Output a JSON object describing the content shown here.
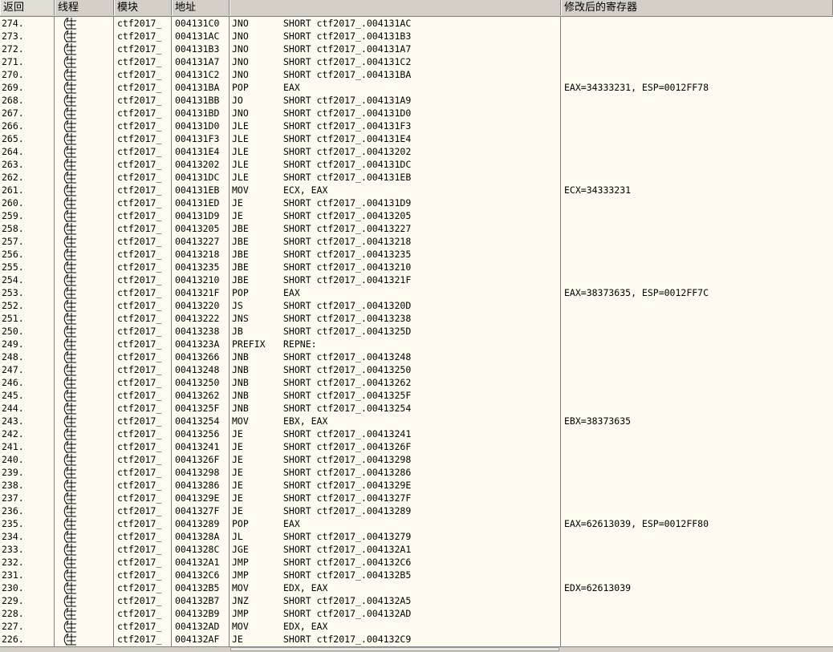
{
  "header": {
    "col_return": "返回",
    "col_thread": "线程",
    "col_module": "模块",
    "col_address": "地址",
    "col_command": "",
    "col_modified_regs": "修改后的寄存器"
  },
  "thread_icon": "main-thread-icon",
  "rows": [
    {
      "ret": "274.",
      "mod": "ctf2017_",
      "addr": "004131C0",
      "mn": "JNO",
      "op": "SHORT ctf2017_.004131AC",
      "reg": ""
    },
    {
      "ret": "273.",
      "mod": "ctf2017_",
      "addr": "004131AC",
      "mn": "JNO",
      "op": "SHORT ctf2017_.004131B3",
      "reg": ""
    },
    {
      "ret": "272.",
      "mod": "ctf2017_",
      "addr": "004131B3",
      "mn": "JNO",
      "op": "SHORT ctf2017_.004131A7",
      "reg": ""
    },
    {
      "ret": "271.",
      "mod": "ctf2017_",
      "addr": "004131A7",
      "mn": "JNO",
      "op": "SHORT ctf2017_.004131C2",
      "reg": ""
    },
    {
      "ret": "270.",
      "mod": "ctf2017_",
      "addr": "004131C2",
      "mn": "JNO",
      "op": "SHORT ctf2017_.004131BA",
      "reg": ""
    },
    {
      "ret": "269.",
      "mod": "ctf2017_",
      "addr": "004131BA",
      "mn": "POP",
      "op": "EAX",
      "reg": "EAX=34333231, ESP=0012FF78"
    },
    {
      "ret": "268.",
      "mod": "ctf2017_",
      "addr": "004131BB",
      "mn": "JO",
      "op": "SHORT ctf2017_.004131A9",
      "reg": ""
    },
    {
      "ret": "267.",
      "mod": "ctf2017_",
      "addr": "004131BD",
      "mn": "JNO",
      "op": "SHORT ctf2017_.004131D0",
      "reg": ""
    },
    {
      "ret": "266.",
      "mod": "ctf2017_",
      "addr": "004131D0",
      "mn": "JLE",
      "op": "SHORT ctf2017_.004131F3",
      "reg": ""
    },
    {
      "ret": "265.",
      "mod": "ctf2017_",
      "addr": "004131F3",
      "mn": "JLE",
      "op": "SHORT ctf2017_.004131E4",
      "reg": ""
    },
    {
      "ret": "264.",
      "mod": "ctf2017_",
      "addr": "004131E4",
      "mn": "JLE",
      "op": "SHORT ctf2017_.00413202",
      "reg": ""
    },
    {
      "ret": "263.",
      "mod": "ctf2017_",
      "addr": "00413202",
      "mn": "JLE",
      "op": "SHORT ctf2017_.004131DC",
      "reg": ""
    },
    {
      "ret": "262.",
      "mod": "ctf2017_",
      "addr": "004131DC",
      "mn": "JLE",
      "op": "SHORT ctf2017_.004131EB",
      "reg": ""
    },
    {
      "ret": "261.",
      "mod": "ctf2017_",
      "addr": "004131EB",
      "mn": "MOV",
      "op": "ECX, EAX",
      "reg": "ECX=34333231"
    },
    {
      "ret": "260.",
      "mod": "ctf2017_",
      "addr": "004131ED",
      "mn": "JE",
      "op": "SHORT ctf2017_.004131D9",
      "reg": ""
    },
    {
      "ret": "259.",
      "mod": "ctf2017_",
      "addr": "004131D9",
      "mn": "JE",
      "op": "SHORT ctf2017_.00413205",
      "reg": ""
    },
    {
      "ret": "258.",
      "mod": "ctf2017_",
      "addr": "00413205",
      "mn": "JBE",
      "op": "SHORT ctf2017_.00413227",
      "reg": ""
    },
    {
      "ret": "257.",
      "mod": "ctf2017_",
      "addr": "00413227",
      "mn": "JBE",
      "op": "SHORT ctf2017_.00413218",
      "reg": ""
    },
    {
      "ret": "256.",
      "mod": "ctf2017_",
      "addr": "00413218",
      "mn": "JBE",
      "op": "SHORT ctf2017_.00413235",
      "reg": ""
    },
    {
      "ret": "255.",
      "mod": "ctf2017_",
      "addr": "00413235",
      "mn": "JBE",
      "op": "SHORT ctf2017_.00413210",
      "reg": ""
    },
    {
      "ret": "254.",
      "mod": "ctf2017_",
      "addr": "00413210",
      "mn": "JBE",
      "op": "SHORT ctf2017_.0041321F",
      "reg": ""
    },
    {
      "ret": "253.",
      "mod": "ctf2017_",
      "addr": "0041321F",
      "mn": "POP",
      "op": "EAX",
      "reg": "EAX=38373635, ESP=0012FF7C"
    },
    {
      "ret": "252.",
      "mod": "ctf2017_",
      "addr": "00413220",
      "mn": "JS",
      "op": "SHORT ctf2017_.0041320D",
      "reg": ""
    },
    {
      "ret": "251.",
      "mod": "ctf2017_",
      "addr": "00413222",
      "mn": "JNS",
      "op": "SHORT ctf2017_.00413238",
      "reg": ""
    },
    {
      "ret": "250.",
      "mod": "ctf2017_",
      "addr": "00413238",
      "mn": "JB",
      "op": "SHORT ctf2017_.0041325D",
      "reg": ""
    },
    {
      "ret": "249.",
      "mod": "ctf2017_",
      "addr": "0041323A",
      "mn": "PREFIX",
      "op": "REPNE:",
      "reg": ""
    },
    {
      "ret": "248.",
      "mod": "ctf2017_",
      "addr": "00413266",
      "mn": "JNB",
      "op": "SHORT ctf2017_.00413248",
      "reg": ""
    },
    {
      "ret": "247.",
      "mod": "ctf2017_",
      "addr": "00413248",
      "mn": "JNB",
      "op": "SHORT ctf2017_.00413250",
      "reg": ""
    },
    {
      "ret": "246.",
      "mod": "ctf2017_",
      "addr": "00413250",
      "mn": "JNB",
      "op": "SHORT ctf2017_.00413262",
      "reg": ""
    },
    {
      "ret": "245.",
      "mod": "ctf2017_",
      "addr": "00413262",
      "mn": "JNB",
      "op": "SHORT ctf2017_.0041325F",
      "reg": ""
    },
    {
      "ret": "244.",
      "mod": "ctf2017_",
      "addr": "0041325F",
      "mn": "JNB",
      "op": "SHORT ctf2017_.00413254",
      "reg": ""
    },
    {
      "ret": "243.",
      "mod": "ctf2017_",
      "addr": "00413254",
      "mn": "MOV",
      "op": "EBX, EAX",
      "reg": "EBX=38373635"
    },
    {
      "ret": "242.",
      "mod": "ctf2017_",
      "addr": "00413256",
      "mn": "JE",
      "op": "SHORT ctf2017_.00413241",
      "reg": ""
    },
    {
      "ret": "241.",
      "mod": "ctf2017_",
      "addr": "00413241",
      "mn": "JE",
      "op": "SHORT ctf2017_.0041326F",
      "reg": ""
    },
    {
      "ret": "240.",
      "mod": "ctf2017_",
      "addr": "0041326F",
      "mn": "JE",
      "op": "SHORT ctf2017_.00413298",
      "reg": ""
    },
    {
      "ret": "239.",
      "mod": "ctf2017_",
      "addr": "00413298",
      "mn": "JE",
      "op": "SHORT ctf2017_.00413286",
      "reg": ""
    },
    {
      "ret": "238.",
      "mod": "ctf2017_",
      "addr": "00413286",
      "mn": "JE",
      "op": "SHORT ctf2017_.0041329E",
      "reg": ""
    },
    {
      "ret": "237.",
      "mod": "ctf2017_",
      "addr": "0041329E",
      "mn": "JE",
      "op": "SHORT ctf2017_.0041327F",
      "reg": ""
    },
    {
      "ret": "236.",
      "mod": "ctf2017_",
      "addr": "0041327F",
      "mn": "JE",
      "op": "SHORT ctf2017_.00413289",
      "reg": ""
    },
    {
      "ret": "235.",
      "mod": "ctf2017_",
      "addr": "00413289",
      "mn": "POP",
      "op": "EAX",
      "reg": "EAX=62613039, ESP=0012FF80"
    },
    {
      "ret": "234.",
      "mod": "ctf2017_",
      "addr": "0041328A",
      "mn": "JL",
      "op": "SHORT ctf2017_.00413279",
      "reg": ""
    },
    {
      "ret": "233.",
      "mod": "ctf2017_",
      "addr": "0041328C",
      "mn": "JGE",
      "op": "SHORT ctf2017_.004132A1",
      "reg": ""
    },
    {
      "ret": "232.",
      "mod": "ctf2017_",
      "addr": "004132A1",
      "mn": "JMP",
      "op": "SHORT ctf2017_.004132C6",
      "reg": ""
    },
    {
      "ret": "231.",
      "mod": "ctf2017_",
      "addr": "004132C6",
      "mn": "JMP",
      "op": "SHORT ctf2017_.004132B5",
      "reg": ""
    },
    {
      "ret": "230.",
      "mod": "ctf2017_",
      "addr": "004132B5",
      "mn": "MOV",
      "op": "EDX, EAX",
      "reg": "EDX=62613039"
    },
    {
      "ret": "229.",
      "mod": "ctf2017_",
      "addr": "004132B7",
      "mn": "JNZ",
      "op": "SHORT ctf2017_.004132A5",
      "reg": ""
    },
    {
      "ret": "228.",
      "mod": "ctf2017_",
      "addr": "004132B9",
      "mn": "JMP",
      "op": "SHORT ctf2017_.004132AD",
      "reg": ""
    },
    {
      "ret": "227.",
      "mod": "ctf2017_",
      "addr": "004132AD",
      "mn": "MOV",
      "op": "EDX, EAX",
      "reg": ""
    },
    {
      "ret": "226.",
      "mod": "ctf2017_",
      "addr": "004132AF",
      "mn": "JE",
      "op": "SHORT ctf2017_.004132C9",
      "reg": ""
    }
  ]
}
